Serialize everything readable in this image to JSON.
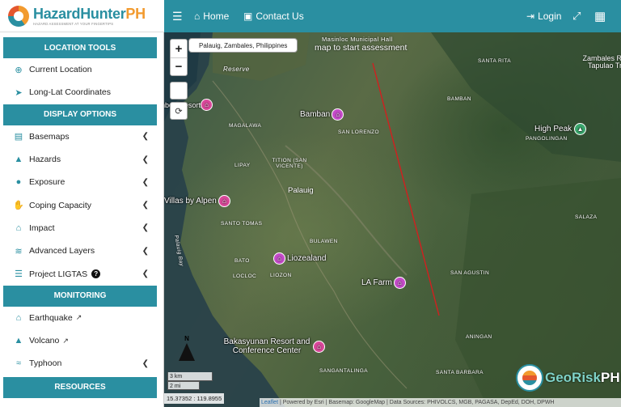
{
  "app": {
    "logo_title_main": "HazardHunter",
    "logo_title_suffix": "PH",
    "logo_subtitle": "HAZARD ASSESSMENT AT YOUR FINGERTIPS"
  },
  "topbar": {
    "home_label": "Home",
    "contact_label": "Contact Us",
    "login_label": "Login"
  },
  "sidebar": {
    "location_tools": {
      "header": "LOCATION TOOLS",
      "items": [
        {
          "label": "Current Location",
          "icon": "crosshair-icon"
        },
        {
          "label": "Long-Lat Coordinates",
          "icon": "location-arrow-icon"
        }
      ]
    },
    "display_options": {
      "header": "DISPLAY OPTIONS",
      "items": [
        {
          "label": "Basemaps",
          "icon": "map-icon"
        },
        {
          "label": "Hazards",
          "icon": "warning-icon"
        },
        {
          "label": "Exposure",
          "icon": "users-icon"
        },
        {
          "label": "Coping Capacity",
          "icon": "hands-icon"
        },
        {
          "label": "Impact",
          "icon": "house-damage-icon"
        },
        {
          "label": "Advanced Layers",
          "icon": "layers-icon"
        },
        {
          "label": "Project LIGTAS",
          "icon": "table-icon"
        }
      ]
    },
    "monitoring": {
      "header": "MONITORING",
      "items": [
        {
          "label": "Earthquake",
          "icon": "earthquake-icon"
        },
        {
          "label": "Volcano",
          "icon": "volcano-icon"
        },
        {
          "label": "Typhoon",
          "icon": "wind-icon"
        }
      ]
    },
    "resources": {
      "header": "RESOURCES"
    }
  },
  "map": {
    "search_tooltip": "Palauig, Zambales, Philippines",
    "hint_text": "map to start assessment",
    "scale_km": "3 km",
    "scale_mi": "2 mi",
    "coordinates": "15.37352 : 119.8955",
    "attribution_leaflet": "Leaflet",
    "attribution_rest": " | Powered by Esri | Basemap: GoogleMap | Data Sources: PHIVOLCS, MGB, PAGASA, DepEd, DOH, DPWH",
    "places": [
      "Masinloc Municipal Hall",
      "Reserve",
      "MAGALAWA",
      "LIPAY",
      "TITION (SAN VICENTE)",
      "Palauig",
      "SANTO TOMAS",
      "Palauig Bay",
      "BULAWEN",
      "BATO",
      "LOCLOC",
      "LIOZON",
      "SAN LORENZO",
      "BAMBAN",
      "SANTA RITA",
      "PANGOLINGAN",
      "SALAZA",
      "SAN AGUSTIN",
      "ANINGAN",
      "SANTA BARBARA",
      "SANGANTALINGA",
      "Zambales R Tapulao Tr"
    ],
    "pois": [
      {
        "name": "Bamban"
      },
      {
        "name": "High Peak"
      },
      {
        "name": "Villas by Alpen"
      },
      {
        "name": "Liozealand"
      },
      {
        "name": "LA Farm"
      },
      {
        "name": "Bakasyunan Resort and Conference Center"
      },
      {
        "name": "Bamboo Resort"
      }
    ],
    "north_label": "N",
    "georisk_main": "GeoRisk",
    "georisk_suffix": "PH"
  },
  "colors": {
    "brand": "#2a8fa1",
    "accent": "#f29a2e",
    "fault_line": "#d21f1f",
    "poi_purple": "#c54bc9",
    "poi_green": "#3aa76d"
  }
}
